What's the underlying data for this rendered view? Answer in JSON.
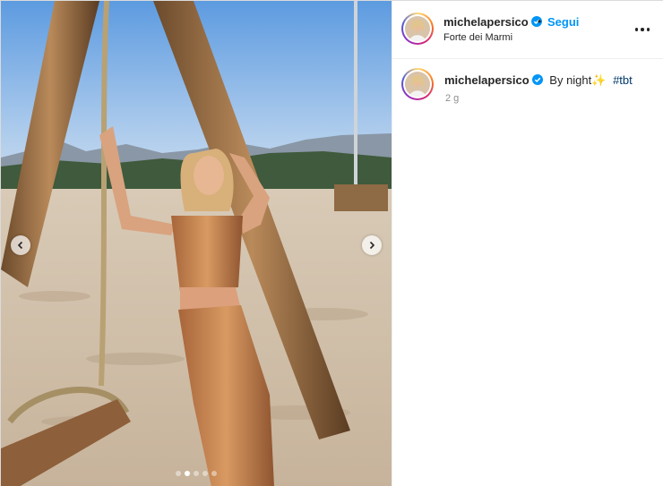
{
  "colors": {
    "link_blue": "#0095f6",
    "hashtag": "#00376b",
    "muted": "#8e8e8e",
    "border": "#dbdbdb"
  },
  "post": {
    "image_icons": {
      "prev": "chevron-left-icon",
      "next": "chevron-right-icon"
    },
    "carousel": {
      "count": 5,
      "active_index": 1
    }
  },
  "header": {
    "username": "michelapersico",
    "verified": true,
    "separator": "•",
    "follow_label": "Segui",
    "location": "Forte dei Marmi",
    "more_icon": "more-options-icon"
  },
  "caption": {
    "username": "michelapersico",
    "text": "By night",
    "emoji": "✨",
    "hashtag": "#tbt",
    "time": "2 g"
  }
}
